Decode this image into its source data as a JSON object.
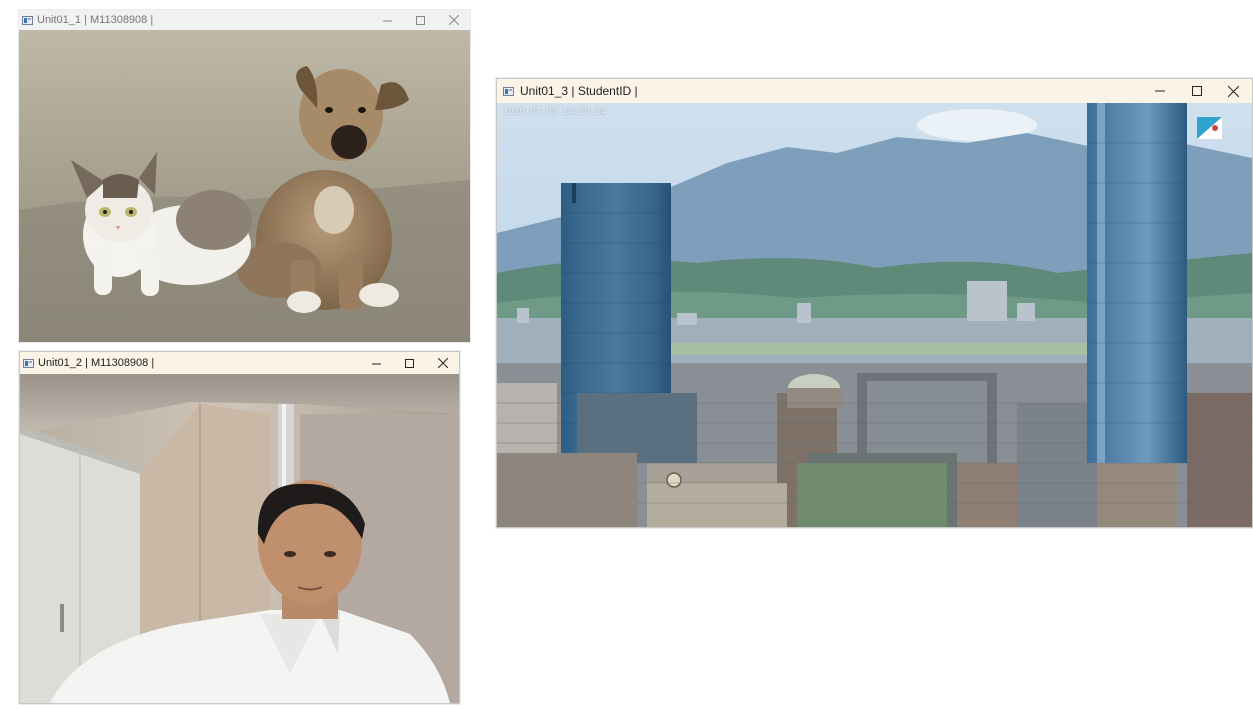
{
  "windows": [
    {
      "id": "w1",
      "title": "Unit01_1 | M11308908 |",
      "controls": {
        "minimize": "–",
        "maximize": "☐",
        "close": "✕"
      },
      "content": "photo of a cat and a puppy sitting on pavement"
    },
    {
      "id": "w2",
      "title": "Unit01_2 | M11308908 |",
      "controls": {
        "minimize": "–",
        "maximize": "☐",
        "close": "✕"
      },
      "content": "webcam image of a man in a white shirt in an office"
    },
    {
      "id": "w3",
      "title": "Unit01_3 | StudentID |",
      "controls": {
        "minimize": "–",
        "maximize": "☐",
        "close": "✕"
      },
      "content": "live camera view of city skyline with mountains",
      "overlay_timestamp": "2026-07-03 14:28:34"
    }
  ],
  "colors": {
    "titlebar_active": "#fbf3e5",
    "titlebar_inactive": "#f1f1f1"
  }
}
